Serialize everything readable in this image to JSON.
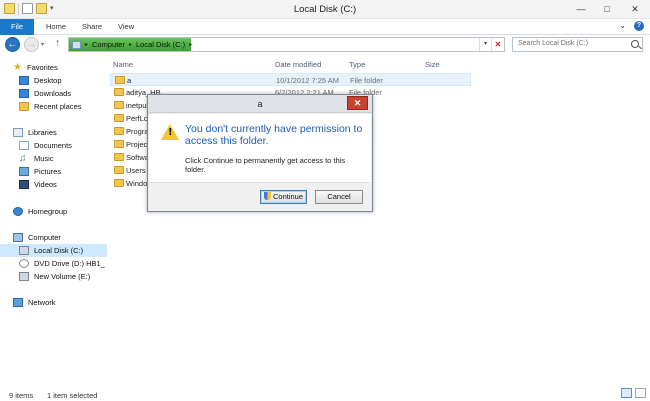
{
  "window": {
    "title": "Local Disk (C:)",
    "controls": {
      "minimize": "—",
      "maximize": "□",
      "close": "✕"
    }
  },
  "ribbon": {
    "tabs": [
      "File",
      "Home",
      "Share",
      "View"
    ],
    "expand_glyph": "⌄",
    "help_glyph": "?"
  },
  "address": {
    "path": [
      "Computer",
      "Local Disk (C:)"
    ],
    "separator": "▸",
    "dropdown_glyph": "▾",
    "clear_glyph": "✕"
  },
  "search": {
    "placeholder": "Search Local Disk (C:)"
  },
  "nav_pane": {
    "favorites": {
      "label": "Favorites",
      "items": [
        "Desktop",
        "Downloads",
        "Recent places"
      ]
    },
    "libraries": {
      "label": "Libraries",
      "items": [
        "Documents",
        "Music",
        "Pictures",
        "Videos"
      ]
    },
    "homegroup": {
      "label": "Homegroup"
    },
    "computer": {
      "label": "Computer",
      "items": [
        "Local Disk (C:)",
        "DVD Drive (D:) HB1_",
        "New Volume (E:)"
      ]
    },
    "network": {
      "label": "Network"
    }
  },
  "columns": {
    "name": "Name",
    "date_modified": "Date modified",
    "type": "Type",
    "size": "Size"
  },
  "files": [
    {
      "name": "a",
      "date": "10/1/2012 7:25 AM",
      "type": "File folder"
    },
    {
      "name": "aditya_HB",
      "date": "6/2/2012 2:21 AM",
      "type": "File folder"
    },
    {
      "name": "inetpub",
      "date": "",
      "type": ""
    },
    {
      "name": "PerfLogs",
      "date": "",
      "type": ""
    },
    {
      "name": "Program Files",
      "date": "",
      "type": ""
    },
    {
      "name": "Projects",
      "date": "",
      "type": ""
    },
    {
      "name": "Software",
      "date": "",
      "type": ""
    },
    {
      "name": "Users",
      "date": "",
      "type": ""
    },
    {
      "name": "Windows",
      "date": "",
      "type": ""
    }
  ],
  "status": {
    "items": "9 items",
    "selected": "1 item selected"
  },
  "dialog": {
    "title": "a",
    "close_glyph": "✕",
    "heading": "You don't currently have permission to access this folder.",
    "text": "Click Continue to permanently get access to this folder.",
    "continue_label": "Continue",
    "cancel_label": "Cancel",
    "warning_glyph": "!"
  }
}
